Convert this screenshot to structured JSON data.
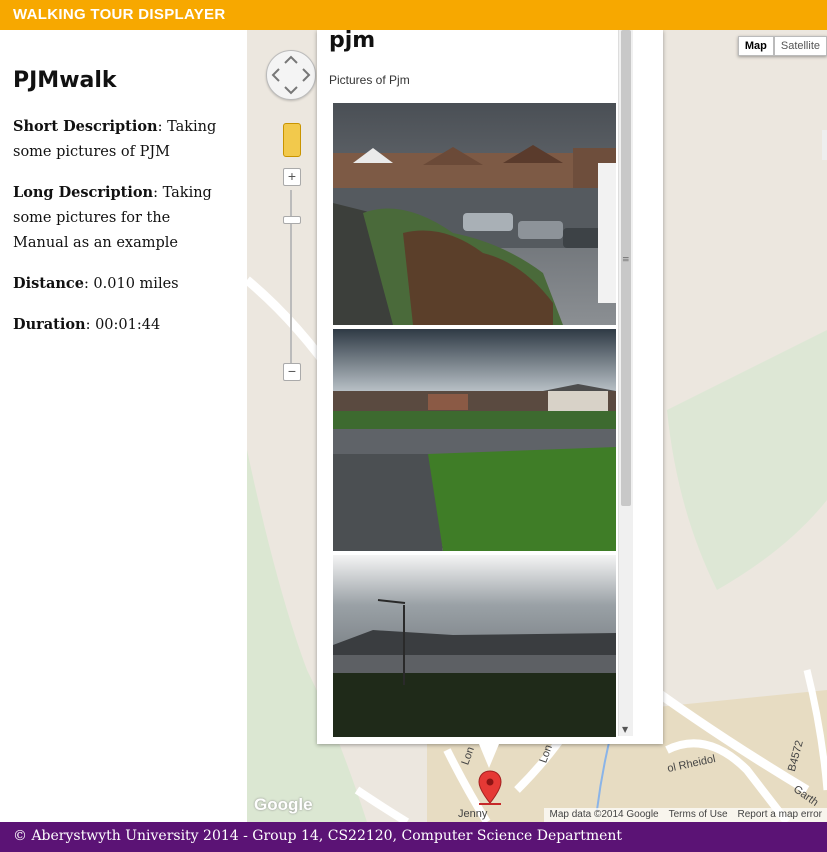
{
  "header": {
    "title": "WALKING TOUR DISPLAYER"
  },
  "walk": {
    "name": "PJMwalk",
    "short_label": "Short Description",
    "short_value": ": Taking some pictures of PJM",
    "long_label": "Long Description",
    "long_value": ": Taking some pictures for the Manual as an example",
    "distance_label": "Distance",
    "distance_value": ": 0.010 miles",
    "duration_label": "Duration",
    "duration_value": ": 00:01:44"
  },
  "map": {
    "type_map": "Map",
    "type_satellite": "Satellite",
    "zoom_in": "+",
    "zoom_out": "−",
    "logo": "Google",
    "attribution_data": "Map data ©2014 Google",
    "attribution_terms": "Terms of Use",
    "attribution_report": "Report a map error",
    "labels": {
      "jenny": "Jenny",
      "rheidol": "ol Rheidol",
      "b4572": "B4572",
      "garth": "Garth",
      "lon1": "Lon",
      "lon2": "Lon"
    }
  },
  "infowindow": {
    "title": "pjm",
    "description": "Pictures of Pjm",
    "photos": [
      "houses-street-photo",
      "grass-verge-photo",
      "field-dusk-photo"
    ]
  },
  "footer": {
    "text": "© Aberystwyth University 2014 - Group 14, CS22120, Computer Science Department"
  },
  "colors": {
    "header": "#f7a800",
    "footer": "#5b1375",
    "map_bg": "#ece7df",
    "marker": "#e53935"
  }
}
